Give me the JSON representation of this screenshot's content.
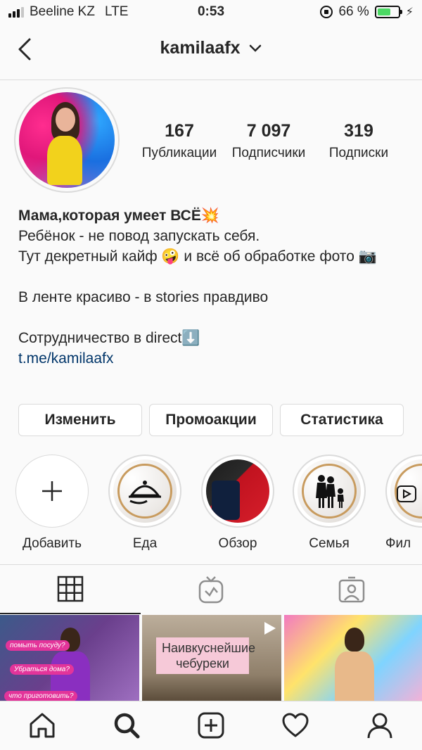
{
  "status_bar": {
    "carrier": "Beeline KZ",
    "network": "LTE",
    "time": "0:53",
    "battery_percent": "66 %",
    "battery_level": 0.66,
    "signal_bars_on": 3,
    "signal_bars_total": 4
  },
  "header": {
    "username": "kamilaafx"
  },
  "profile": {
    "stats": [
      {
        "value": "167",
        "label": "Публикации"
      },
      {
        "value": "7 097",
        "label": "Подписчики"
      },
      {
        "value": "319",
        "label": "Подписки"
      }
    ],
    "bio": {
      "name": "Мама,которая умеет ВСЁ💥",
      "lines": [
        "Ребёнок - не повод запускать себя.",
        "Тут декретный кайф 🤪 и всё об обработке фото 📷",
        "В ленте красиво - в stories правдиво",
        "Сотрудничество в direct⬇️"
      ],
      "link": "t.me/kamilaafx"
    }
  },
  "buttons": {
    "edit": "Изменить",
    "promotions": "Промоакции",
    "insights": "Статистика"
  },
  "highlights": [
    {
      "label": "Добавить",
      "icon": "plus-icon"
    },
    {
      "label": "Еда",
      "icon": "cloche-icon"
    },
    {
      "label": "Обзор",
      "icon": "clothes-photo"
    },
    {
      "label": "Семья",
      "icon": "family-icon"
    },
    {
      "label": "Фил",
      "icon": "video-icon"
    }
  ],
  "tabs": [
    {
      "name": "grid-tab",
      "icon": "grid-icon",
      "active": true
    },
    {
      "name": "igtv-tab",
      "icon": "igtv-icon",
      "active": false
    },
    {
      "name": "tagged-tab",
      "icon": "tagged-icon",
      "active": false
    }
  ],
  "grid_posts": {
    "post1_pills": [
      "помыть посуду?",
      "Убраться дома?",
      "что приготовить?"
    ],
    "post2_text": "Наивкуснейшие чебуреки"
  },
  "bottom_nav": [
    {
      "name": "home",
      "icon": "home-icon"
    },
    {
      "name": "search",
      "icon": "search-icon"
    },
    {
      "name": "new-post",
      "icon": "add-post-icon"
    },
    {
      "name": "activity",
      "icon": "heart-icon"
    },
    {
      "name": "profile",
      "icon": "profile-icon"
    }
  ],
  "colors": {
    "link": "#003569",
    "border": "#dbdbdb",
    "battery": "#4cd964",
    "text": "#262626"
  }
}
